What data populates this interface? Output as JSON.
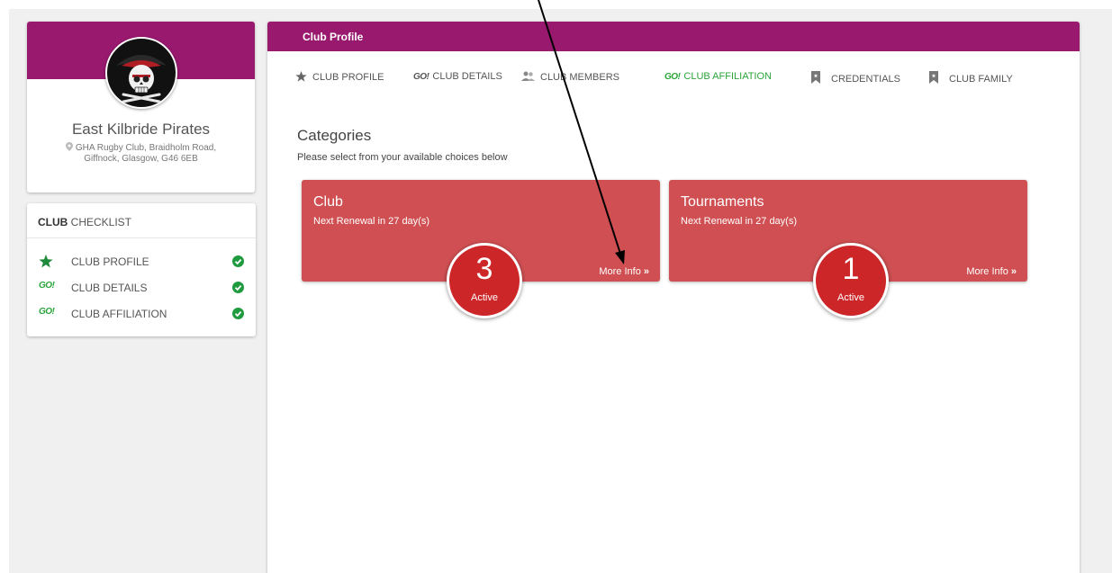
{
  "profile": {
    "club_name": "East Kilbride Pirates",
    "address_line1": "GHA Rugby Club, Braidholm Road,",
    "address_line2": "Giffnock, Glasgow, G46 6EB"
  },
  "checklist": {
    "heading_bold": "CLUB",
    "heading_rest": " CHECKLIST",
    "items": [
      {
        "lead": "star-icon",
        "label": "CLUB PROFILE"
      },
      {
        "lead": "GO!",
        "label": "CLUB DETAILS"
      },
      {
        "lead": "GO!",
        "label": "CLUB AFFILIATION"
      }
    ]
  },
  "main": {
    "header": "Club Profile",
    "tabs": [
      {
        "label": "CLUB PROFILE",
        "icon": "star-icon"
      },
      {
        "label": "CLUB DETAILS",
        "icon": "GO!"
      },
      {
        "label": "CLUB MEMBERS",
        "icon": "people-icon"
      },
      {
        "label": "CLUB AFFILIATION",
        "icon": "GO!",
        "active": true
      },
      {
        "label": "CREDENTIALS",
        "icon": "bookmark-icon"
      },
      {
        "label": "CLUB FAMILY",
        "icon": "bookmark-icon"
      }
    ],
    "categories_title": "Categories",
    "categories_subtitle": "Please select from your available choices below",
    "tiles": [
      {
        "title": "Club",
        "renewal": "Next Renewal in 27 day(s)",
        "more": "More Info",
        "count": "3",
        "count_label": "Active"
      },
      {
        "title": "Tournaments",
        "renewal": "Next Renewal in 27 day(s)",
        "more": "More Info",
        "count": "1",
        "count_label": "Active"
      }
    ]
  },
  "colors": {
    "brand": "#99196f",
    "tile": "#cf4f52",
    "badge": "#cc2629",
    "go_green": "#2ba43a"
  }
}
